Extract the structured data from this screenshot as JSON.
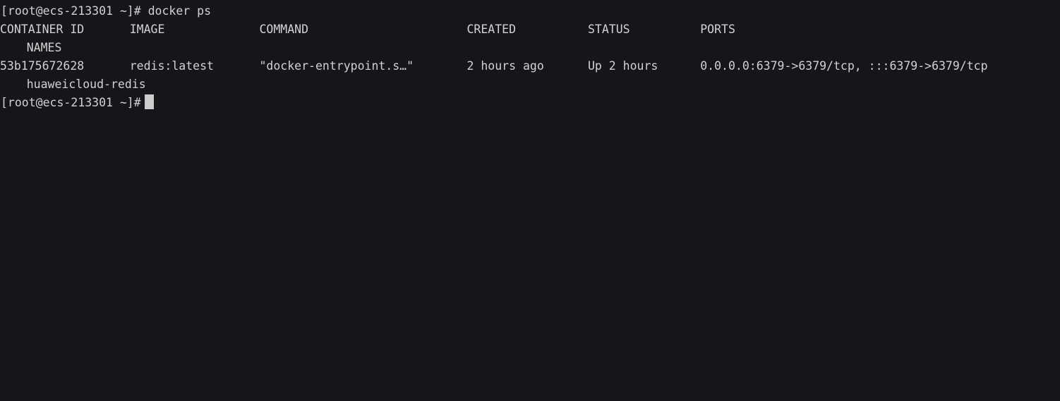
{
  "terminal": {
    "background_color": "#141619",
    "foreground_color": "#d2d2d2",
    "cursor_color": "#cccccc",
    "prompt": "[root@ecs-213301 ~]#",
    "command": "docker ps",
    "final_prompt": "[root@ecs-213301 ~]#"
  },
  "table": {
    "headers": {
      "container_id": "CONTAINER ID",
      "image": "IMAGE",
      "command": "COMMAND",
      "created": "CREATED",
      "status": "STATUS",
      "ports": "PORTS",
      "names": "NAMES"
    },
    "rows": [
      {
        "container_id": "53b175672628",
        "image": "redis:latest",
        "command": "\"docker-entrypoint.s…\"",
        "created": "2 hours ago",
        "status": "Up 2 hours",
        "ports": "0.0.0.0:6379->6379/tcp, :::6379->6379/tcp",
        "names": "huaweicloud-redis"
      }
    ]
  }
}
